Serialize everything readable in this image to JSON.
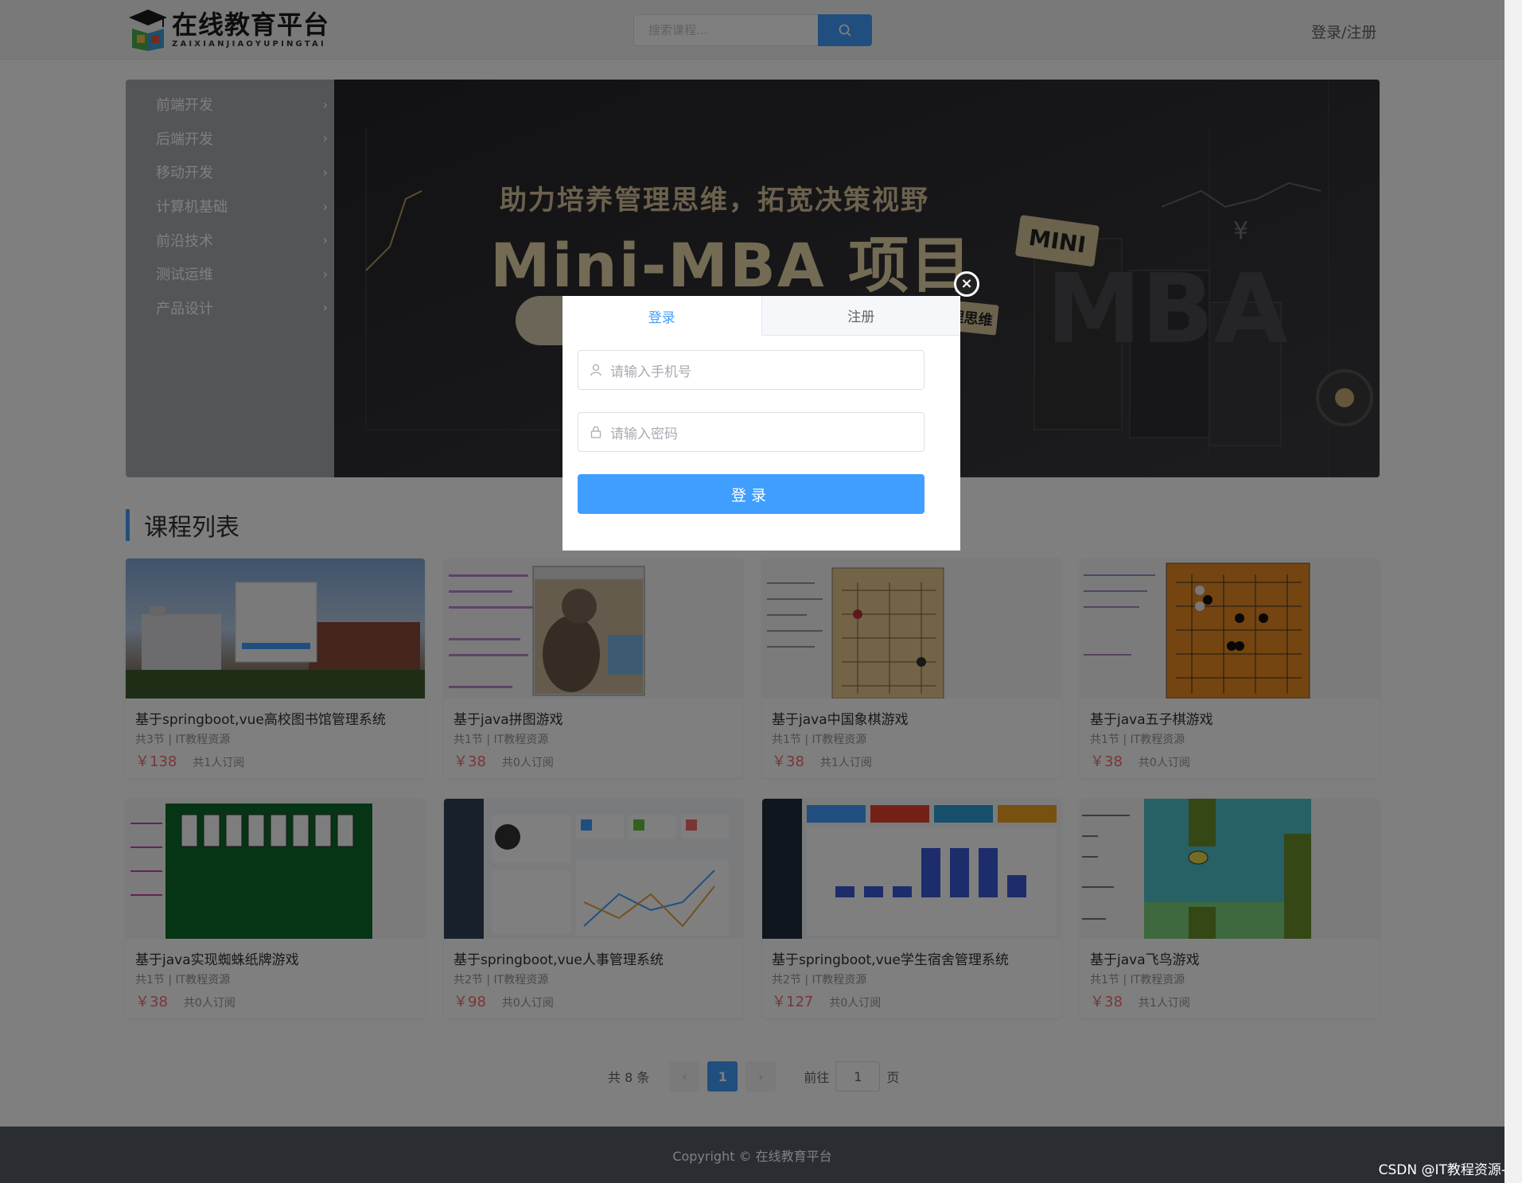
{
  "header": {
    "logo_title": "在线教育平台",
    "logo_subtitle": "ZAIXIANJIAOYUPINGTAI",
    "search_placeholder": "搜索课程...",
    "login_register": "登录/注册"
  },
  "categories": [
    "前端开发",
    "后端开发",
    "移动开发",
    "计算机基础",
    "前沿技术",
    "测试运维",
    "产品设计"
  ],
  "banner": {
    "subtitle": "助力培养管理思维，拓宽决策视野",
    "title": "Mini-MBA 项目",
    "tag_mini": "MINI",
    "tag_mgmt": "管理思维",
    "big_text": "MBA"
  },
  "section_title": "课程列表",
  "courses": [
    {
      "title": "基于springboot,vue高校图书馆管理系统",
      "meta": "共3节 | IT教程资源",
      "price": "￥138",
      "subs": "共1人订阅"
    },
    {
      "title": "基于java拼图游戏",
      "meta": "共1节 | IT教程资源",
      "price": "￥38",
      "subs": "共0人订阅"
    },
    {
      "title": "基于java中国象棋游戏",
      "meta": "共1节 | IT教程资源",
      "price": "￥38",
      "subs": "共1人订阅"
    },
    {
      "title": "基于java五子棋游戏",
      "meta": "共1节 | IT教程资源",
      "price": "￥38",
      "subs": "共0人订阅"
    },
    {
      "title": "基于java实现蜘蛛纸牌游戏",
      "meta": "共1节 | IT教程资源",
      "price": "￥38",
      "subs": "共0人订阅"
    },
    {
      "title": "基于springboot,vue人事管理系统",
      "meta": "共2节 | IT教程资源",
      "price": "￥98",
      "subs": "共0人订阅"
    },
    {
      "title": "基于springboot,vue学生宿舍管理系统",
      "meta": "共2节 | IT教程资源",
      "price": "￥127",
      "subs": "共0人订阅"
    },
    {
      "title": "基于java飞鸟游戏",
      "meta": "共1节 | IT教程资源",
      "price": "￥38",
      "subs": "共1人订阅"
    }
  ],
  "pagination": {
    "total": "共 8 条",
    "current": "1",
    "goto_label": "前往",
    "goto_value": "1",
    "page_unit": "页"
  },
  "footer": {
    "copyright": "Copyright © 在线教育平台"
  },
  "watermark": "CSDN @IT教程资源-",
  "modal": {
    "tab_login": "登录",
    "tab_register": "注册",
    "phone_placeholder": "请输入手机号",
    "password_placeholder": "请输入密码",
    "submit": "登录",
    "close": "×"
  },
  "colors": {
    "primary": "#409eff",
    "price": "#f56c6c",
    "footer": "#545c64"
  }
}
